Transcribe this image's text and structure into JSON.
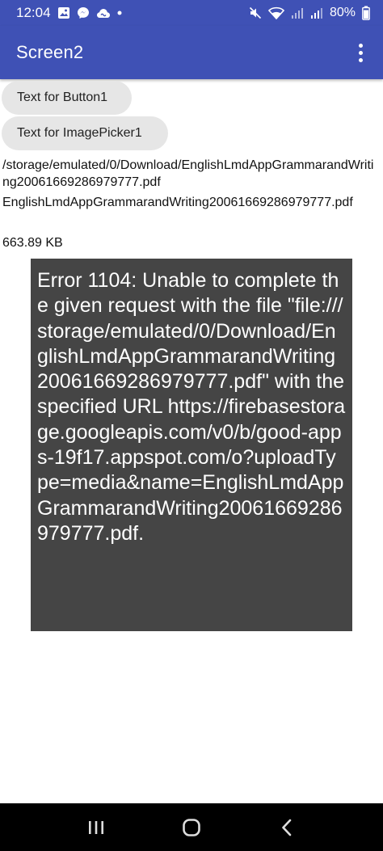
{
  "status_bar": {
    "time": "12:04",
    "battery": "80%"
  },
  "app_bar": {
    "title": "Screen2"
  },
  "buttons": {
    "button1_label": "Text for Button1",
    "imagepicker1_label": "Text for ImagePicker1"
  },
  "labels": {
    "path": "/storage/emulated/0/Download/EnglishLmdAppGrammarandWriting20061669286979777.pdf",
    "filename": "EnglishLmdAppGrammarandWriting20061669286979777.pdf",
    "size": "663.89 KB"
  },
  "toast": {
    "message": "Error 1104: Unable to complete the given request with the file \"file:///storage/emulated/0/Download/EnglishLmdAppGrammarandWriting20061669286979777.pdf\" with the specified URL https://firebasestorage.googleapis.com/v0/b/good-apps-19f17.appspot.com/o?uploadType=media&name=EnglishLmdAppGrammarandWriting20061669286979777.pdf."
  },
  "icons": {
    "status_left": [
      "photo-icon",
      "messenger-icon",
      "cloud-icon",
      "dot-icon"
    ],
    "status_right": [
      "mute-icon",
      "wifi-icon",
      "signal-icon",
      "signal-icon",
      "battery-icon"
    ],
    "app_bar": [
      "overflow-menu-icon"
    ],
    "nav": [
      "recents-icon",
      "home-icon",
      "back-icon"
    ]
  },
  "colors": {
    "app_bar": "#3f51b5",
    "button_bg": "#e6e6e6",
    "toast_bg": "#454545",
    "nav_bar": "#000000"
  }
}
